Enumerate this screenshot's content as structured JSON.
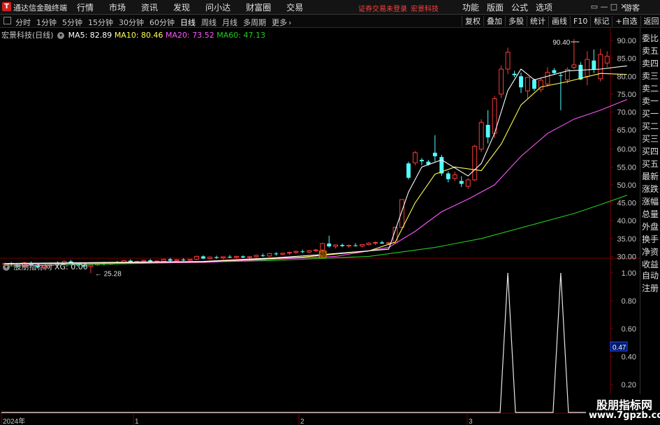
{
  "app": {
    "logo": "T",
    "title": "通达信金融终端"
  },
  "main_menu": [
    "行情",
    "市场",
    "资讯",
    "发现",
    "问小达",
    "财富圈",
    "交易"
  ],
  "notice": "证券交易未登录",
  "notice_name": "宏景科技",
  "right_menu": [
    "功能",
    "版面",
    "公式",
    "选项"
  ],
  "window_controls": [
    "▭",
    "—",
    "□",
    "✕"
  ],
  "guest": "游客",
  "periods": [
    "分时",
    "1分钟",
    "5分钟",
    "15分钟",
    "30分钟",
    "60分钟",
    "日线",
    "周线",
    "月线",
    "多周期",
    "更多"
  ],
  "period_more_arrow": "›",
  "active_period": "日线",
  "tools": [
    "复权",
    "叠加",
    "多股",
    "统计",
    "画线",
    "F10",
    "标记",
    "+自选",
    "返回"
  ],
  "side_r": "R",
  "side_panel": [
    "委比",
    "卖五",
    "卖四",
    "卖三",
    "卖二",
    "卖一",
    "买一",
    "买二",
    "买三",
    "买四",
    "买五",
    "最新",
    "涨跌",
    "涨幅",
    "总量",
    "外盘",
    "换手",
    "净资",
    "收益",
    "自动",
    "注册"
  ],
  "main_legend": {
    "stock": "宏景科技(日线)",
    "ma5": "MA5: 82.89",
    "ma10": "MA10: 80.46",
    "ma20": "MA20: 73.52",
    "ma60": "MA60: 47.13",
    "colors": {
      "stock": "#c8c8c8",
      "ma5": "#ffffff",
      "ma10": "#ffff55",
      "ma20": "#ff55ff",
      "ma60": "#22cc22"
    }
  },
  "sub_legend": {
    "name": "股朋指标网",
    "value": "XG: 0.00"
  },
  "price_axis": {
    "min": 25,
    "max": 90,
    "ticks": [
      "90.00",
      "85.00",
      "80.00",
      "75.00",
      "70.00",
      "65.00",
      "60.00",
      "55.00",
      "50.00",
      "45.00",
      "40.00",
      "35.00",
      "30.00"
    ],
    "high_label": "90.40",
    "low_label": "25.28"
  },
  "sub_axis": {
    "ticks": [
      "1.00",
      "0.80",
      "0.60",
      "0.40",
      "0.20"
    ],
    "current": "0.47"
  },
  "time_axis": [
    "2024年",
    "1",
    "2",
    "3"
  ],
  "event_marker": "预",
  "watermark": {
    "title": "股朋指标网",
    "url": "www.7gpzb.com"
  },
  "chart_data": {
    "type": "candlestick",
    "candles": [
      [
        27.8,
        28.3,
        27.5,
        28.0
      ],
      [
        28.0,
        28.4,
        27.4,
        27.7
      ],
      [
        27.6,
        28.0,
        26.9,
        27.2
      ],
      [
        27.2,
        28.5,
        27.0,
        28.2
      ],
      [
        28.2,
        28.6,
        27.3,
        27.5
      ],
      [
        27.5,
        28.0,
        26.8,
        27.0
      ],
      [
        27.0,
        27.6,
        26.5,
        27.4
      ],
      [
        27.4,
        28.3,
        27.1,
        28.1
      ],
      [
        28.1,
        28.6,
        27.6,
        27.8
      ],
      [
        27.8,
        28.9,
        27.6,
        28.6
      ],
      [
        28.6,
        29.0,
        27.8,
        28.0
      ],
      [
        28.0,
        28.3,
        27.2,
        27.5
      ],
      [
        27.5,
        27.9,
        26.9,
        27.2
      ],
      [
        27.2,
        27.8,
        25.3,
        27.6
      ],
      [
        27.6,
        28.3,
        27.3,
        28.0
      ],
      [
        28.0,
        28.5,
        27.5,
        27.8
      ],
      [
        27.8,
        28.4,
        27.6,
        28.3
      ],
      [
        28.3,
        28.7,
        27.9,
        28.1
      ],
      [
        28.1,
        29.0,
        28.0,
        28.8
      ],
      [
        28.8,
        29.2,
        28.2,
        28.4
      ],
      [
        28.4,
        28.8,
        27.9,
        28.6
      ],
      [
        28.6,
        29.1,
        28.3,
        28.9
      ],
      [
        28.9,
        29.3,
        28.2,
        28.5
      ],
      [
        28.5,
        28.9,
        28.0,
        28.7
      ],
      [
        28.7,
        29.4,
        28.5,
        29.2
      ],
      [
        29.2,
        29.6,
        28.6,
        28.8
      ],
      [
        28.8,
        29.3,
        28.5,
        29.1
      ],
      [
        29.1,
        29.5,
        28.7,
        28.9
      ],
      [
        28.9,
        29.3,
        28.6,
        29.2
      ],
      [
        29.2,
        30.2,
        29.0,
        30.0
      ],
      [
        30.0,
        30.3,
        29.2,
        29.4
      ],
      [
        29.4,
        30.0,
        29.1,
        29.8
      ],
      [
        29.8,
        30.2,
        29.3,
        29.6
      ],
      [
        29.6,
        30.0,
        29.2,
        29.9
      ],
      [
        29.9,
        30.4,
        29.5,
        29.7
      ],
      [
        29.7,
        30.2,
        29.4,
        30.0
      ],
      [
        30.0,
        30.3,
        29.5,
        29.7
      ],
      [
        29.7,
        30.1,
        29.3,
        29.9
      ],
      [
        29.9,
        30.5,
        29.6,
        30.3
      ],
      [
        30.3,
        30.8,
        29.9,
        30.1
      ],
      [
        30.1,
        31.0,
        29.8,
        30.8
      ],
      [
        30.8,
        31.2,
        30.2,
        30.6
      ],
      [
        30.6,
        31.0,
        30.3,
        30.9
      ],
      [
        30.9,
        31.4,
        30.4,
        31.1
      ],
      [
        31.1,
        31.6,
        30.7,
        31.4
      ],
      [
        31.4,
        31.9,
        30.9,
        31.2
      ],
      [
        31.2,
        31.8,
        30.9,
        31.6
      ],
      [
        31.6,
        32.1,
        31.2,
        31.8
      ],
      [
        31.8,
        33.8,
        31.5,
        33.6
      ],
      [
        33.6,
        35.8,
        32.5,
        32.8
      ],
      [
        32.8,
        33.4,
        32.2,
        33.2
      ],
      [
        33.2,
        33.6,
        32.6,
        32.9
      ],
      [
        32.9,
        33.3,
        32.4,
        33.1
      ],
      [
        33.1,
        33.7,
        32.7,
        32.9
      ],
      [
        32.9,
        33.4,
        32.5,
        33.3
      ],
      [
        33.3,
        34.0,
        33.0,
        33.7
      ],
      [
        33.7,
        34.2,
        33.2,
        33.9
      ],
      [
        33.9,
        34.4,
        33.5,
        33.6
      ],
      [
        33.6,
        34.0,
        33.2,
        33.8
      ],
      [
        33.8,
        38.3,
        33.6,
        38.1
      ],
      [
        38.1,
        46.0,
        37.9,
        45.9
      ],
      [
        56.0,
        56.5,
        51.5,
        52.0
      ],
      [
        56.2,
        59.5,
        55.5,
        59.0
      ],
      [
        57.0,
        57.5,
        55.5,
        56.6
      ],
      [
        56.5,
        57.0,
        55.4,
        55.7
      ],
      [
        59.0,
        63.5,
        56.5,
        58.0
      ],
      [
        57.8,
        58.4,
        52.5,
        53.2
      ],
      [
        53.2,
        53.8,
        50.7,
        51.6
      ],
      [
        51.8,
        53.7,
        51.1,
        52.8
      ],
      [
        51.1,
        52.4,
        49.4,
        50.3
      ],
      [
        49.6,
        51.9,
        48.9,
        51.4
      ],
      [
        51.4,
        60.8,
        51.0,
        60.4
      ],
      [
        60.0,
        68.0,
        59.2,
        67.1
      ],
      [
        66.4,
        70.5,
        61.2,
        62.9
      ],
      [
        64.0,
        74.5,
        62.7,
        73.7
      ],
      [
        75.0,
        83.0,
        73.9,
        82.0
      ],
      [
        82.0,
        88.0,
        80.6,
        86.7
      ],
      [
        80.7,
        81.5,
        79.7,
        80.3
      ],
      [
        80.0,
        81.0,
        75.3,
        76.9
      ],
      [
        75.9,
        79.7,
        73.8,
        79.7
      ],
      [
        79.0,
        79.3,
        75.9,
        76.5
      ],
      [
        76.3,
        79.6,
        75.5,
        78.9
      ],
      [
        77.8,
        82.5,
        77.0,
        81.1
      ],
      [
        81.7,
        82.3,
        80.5,
        80.9
      ],
      [
        80.3,
        81.0,
        70.5,
        80.1
      ],
      [
        79.0,
        82.5,
        78.0,
        81.9
      ],
      [
        82.5,
        90.4,
        82.0,
        83.2
      ],
      [
        83.2,
        84.0,
        78.9,
        79.1
      ],
      [
        80.0,
        87.0,
        77.5,
        84.7
      ],
      [
        84.4,
        87.5,
        80.9,
        81.9
      ],
      [
        79.3,
        87.7,
        78.5,
        86.1
      ],
      [
        83.7,
        87.0,
        82.5,
        85.6
      ]
    ],
    "ma5": [
      [
        0,
        28.0
      ],
      [
        30,
        28.6
      ],
      [
        40,
        29.5
      ],
      [
        48,
        30.5
      ],
      [
        58,
        32.0
      ],
      [
        61,
        48.0
      ],
      [
        63,
        55.0
      ],
      [
        66,
        57.0
      ],
      [
        70,
        52.5
      ],
      [
        72,
        56.0
      ],
      [
        74,
        64.0
      ],
      [
        76,
        76.0
      ],
      [
        78,
        82.0
      ],
      [
        80,
        79.0
      ],
      [
        85,
        81.5
      ],
      [
        90,
        82.0
      ],
      [
        94,
        82.9
      ]
    ],
    "ma10": [
      [
        0,
        27.9
      ],
      [
        30,
        28.5
      ],
      [
        45,
        29.8
      ],
      [
        55,
        31.5
      ],
      [
        59,
        34.0
      ],
      [
        62,
        45.0
      ],
      [
        65,
        53.0
      ],
      [
        68,
        55.0
      ],
      [
        72,
        54.0
      ],
      [
        75,
        61.0
      ],
      [
        78,
        72.0
      ],
      [
        81,
        77.0
      ],
      [
        85,
        78.5
      ],
      [
        90,
        80.8
      ],
      [
        94,
        80.5
      ]
    ],
    "ma20": [
      [
        0,
        27.8
      ],
      [
        30,
        28.3
      ],
      [
        50,
        30.0
      ],
      [
        58,
        32.5
      ],
      [
        62,
        37.0
      ],
      [
        66,
        42.5
      ],
      [
        70,
        46.0
      ],
      [
        74,
        50.0
      ],
      [
        78,
        58.0
      ],
      [
        82,
        64.0
      ],
      [
        86,
        68.0
      ],
      [
        90,
        70.5
      ],
      [
        94,
        73.5
      ]
    ],
    "ma60": [
      [
        0,
        27.3
      ],
      [
        20,
        28.0
      ],
      [
        40,
        28.8
      ],
      [
        55,
        30.0
      ],
      [
        65,
        32.5
      ],
      [
        72,
        35.0
      ],
      [
        80,
        39.0
      ],
      [
        86,
        42.0
      ],
      [
        90,
        44.5
      ],
      [
        94,
        47.1
      ]
    ],
    "xg_signals": [
      {
        "x": 76,
        "value": 1.0
      },
      {
        "x": 84,
        "value": 1.0
      }
    ]
  }
}
